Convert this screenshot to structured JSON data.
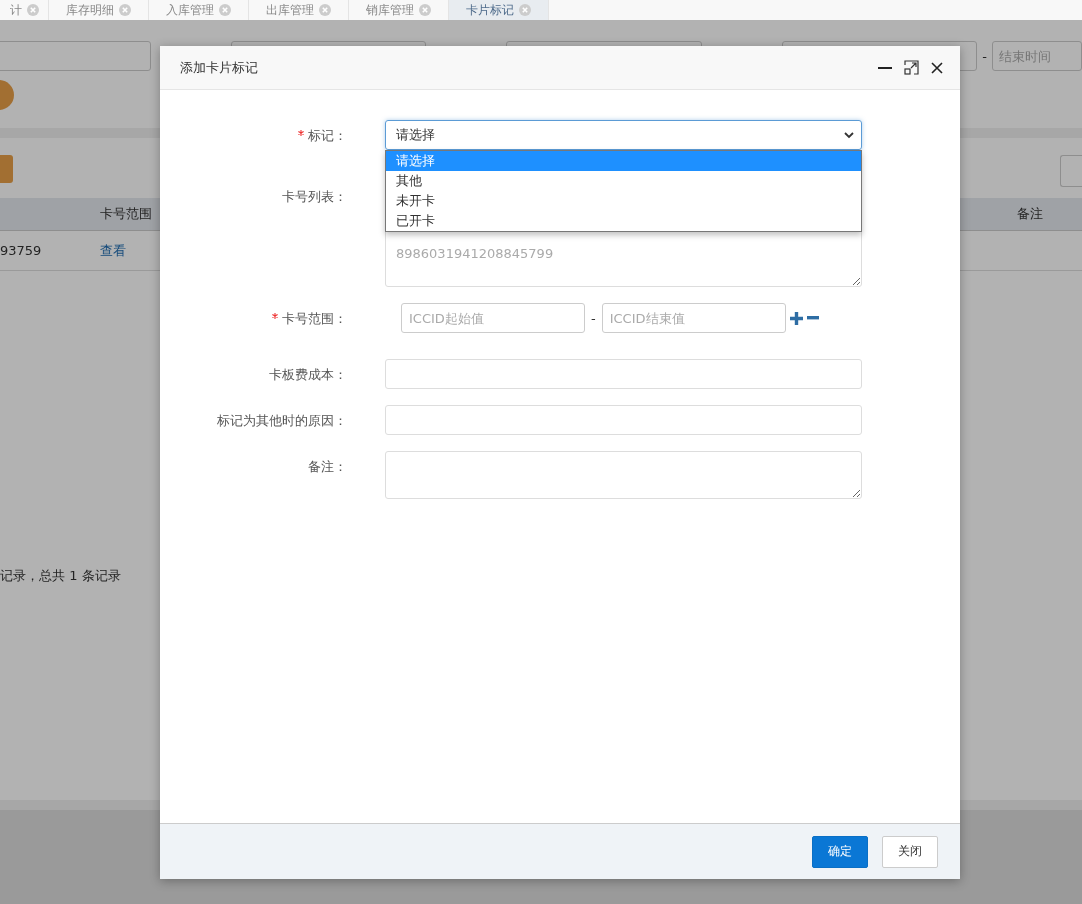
{
  "tabs": [
    {
      "label": "计",
      "selected": false
    },
    {
      "label": "库存明细",
      "selected": false
    },
    {
      "label": "入库管理",
      "selected": false
    },
    {
      "label": "出库管理",
      "selected": false
    },
    {
      "label": "销库管理",
      "selected": false
    },
    {
      "label": "卡片标记",
      "selected": true
    }
  ],
  "search_bar": {
    "separator": "-",
    "end_time_placeholder": "结束时间"
  },
  "table": {
    "columns": [
      {},
      {
        "label": "卡号范围"
      },
      {
        "label": "备注"
      }
    ],
    "rows": [
      {
        "cells": [
          "93759",
          "查看"
        ]
      }
    ]
  },
  "pagination": {
    "summary": "记录，总共 1 条记录"
  },
  "dialog": {
    "title": "添加卡片标记",
    "fields": [
      {
        "kind": "select",
        "label": "标记：",
        "required": true,
        "value": "请选择",
        "expanded": true,
        "options": [
          {
            "label": "请选择",
            "selected": true
          },
          {
            "label": "其他",
            "selected": false
          },
          {
            "label": "未开卡",
            "selected": false
          },
          {
            "label": "已开卡",
            "selected": false
          }
        ]
      },
      {
        "kind": "list",
        "label": "卡号列表：",
        "required": false,
        "placeholder": "8986031941208845799"
      },
      {
        "kind": "range",
        "label": "卡号范围：",
        "required": true,
        "start_placeholder": "ICCID起始值",
        "separator": "-",
        "end_placeholder": "ICCID结束值"
      },
      {
        "kind": "input",
        "label": "卡板费成本：",
        "required": false
      },
      {
        "kind": "input",
        "label": "标记为其他时的原因：",
        "required": false
      },
      {
        "kind": "textarea",
        "label": "备注：",
        "required": false
      }
    ],
    "buttons": [
      {
        "label": "确定",
        "kind": "primary"
      },
      {
        "label": "关闭",
        "kind": "default"
      }
    ]
  }
}
